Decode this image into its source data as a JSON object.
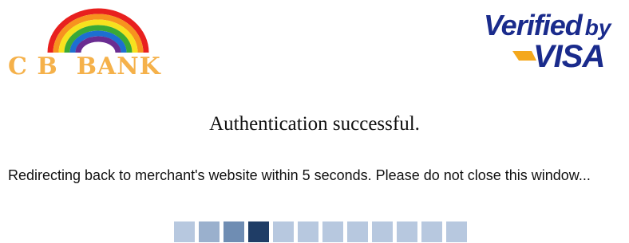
{
  "bank": {
    "name": "C B  BANK",
    "colors": {
      "text": "#f5b14a",
      "rainbow": [
        "#e8201e",
        "#f7931e",
        "#f7e21e",
        "#3aa935",
        "#1d6fd1",
        "#6a2c91"
      ]
    }
  },
  "visa": {
    "line1": "Verified",
    "line1_suffix": "by",
    "line2": "VISA",
    "colors": {
      "text": "#1a2b8c",
      "accent": "#f4a81d"
    }
  },
  "status": {
    "title": "Authentication successful.",
    "message": "Redirecting back to merchant's website within 5 seconds. Please do not close this window..."
  },
  "progress": {
    "total_blocks": 12,
    "active_index": 3,
    "colors": {
      "inactive": "#b7c8df",
      "active": "#1f3d66"
    }
  }
}
